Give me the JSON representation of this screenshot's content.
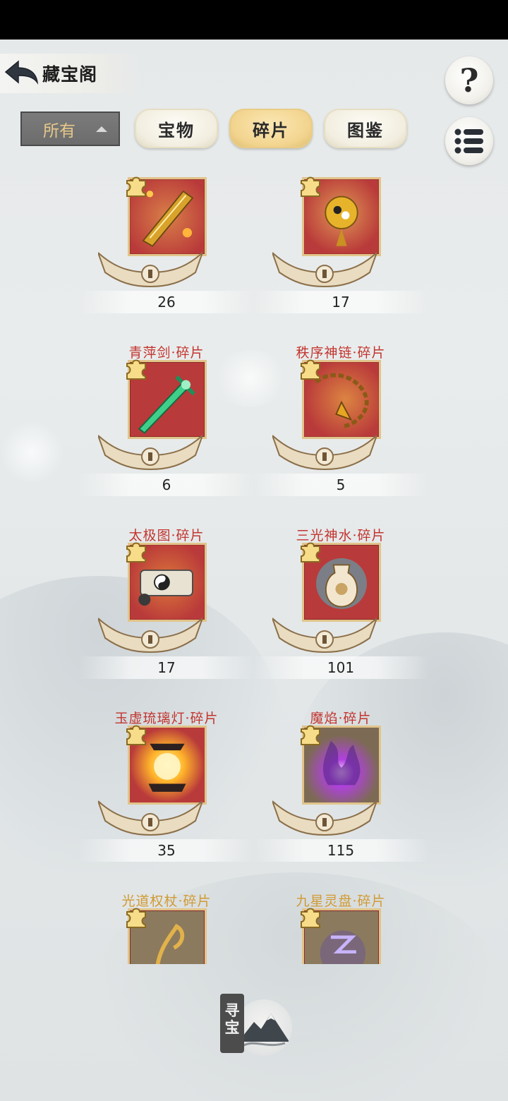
{
  "header": {
    "title": "藏宝阁",
    "help_glyph": "?"
  },
  "filter": {
    "selected": "所有"
  },
  "tabs": [
    {
      "label": "宝物",
      "active": false
    },
    {
      "label": "碎片",
      "active": true
    },
    {
      "label": "图鉴",
      "active": false
    }
  ],
  "items": [
    {
      "name": "",
      "count": "26",
      "frame": "red",
      "icon": "zither-icon"
    },
    {
      "name": "",
      "count": "17",
      "frame": "red",
      "icon": "golden-banner-icon"
    },
    {
      "name": "青萍剑·碎片",
      "count": "6",
      "frame": "red",
      "icon": "jade-sword-icon"
    },
    {
      "name": "秩序神链·碎片",
      "count": "5",
      "frame": "red",
      "icon": "divine-chain-icon"
    },
    {
      "name": "太极图·碎片",
      "count": "17",
      "frame": "red",
      "icon": "taiji-scroll-icon"
    },
    {
      "name": "三光神水·碎片",
      "count": "101",
      "frame": "red",
      "icon": "divine-water-flask-icon"
    },
    {
      "name": "玉虚琉璃灯·碎片",
      "count": "35",
      "frame": "red",
      "icon": "glazed-lamp-icon"
    },
    {
      "name": "魔焰·碎片",
      "count": "115",
      "frame": "purple",
      "icon": "demon-flame-icon"
    },
    {
      "name": "光道权杖·碎片",
      "count": "",
      "frame": "gold",
      "icon": "light-scepter-icon"
    },
    {
      "name": "九星灵盘·碎片",
      "count": "",
      "frame": "gold",
      "icon": "nine-star-disc-icon"
    }
  ],
  "seek": {
    "label": "寻宝"
  },
  "colors": {
    "card_red": "#b93a3a",
    "tab_active": "#f2d48e",
    "name_red": "#c2352f",
    "name_gold": "#d19a32"
  }
}
